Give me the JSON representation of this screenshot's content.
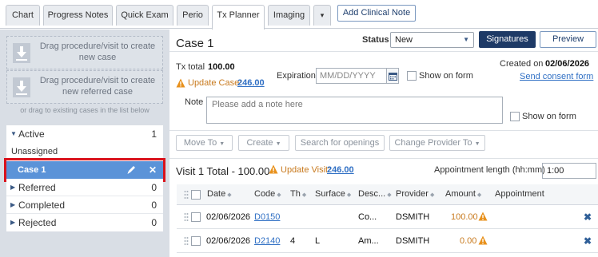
{
  "tabs": [
    {
      "label": "Chart",
      "active": false
    },
    {
      "label": "Progress Notes",
      "active": false
    },
    {
      "label": "Quick Exam",
      "active": false
    },
    {
      "label": "Perio",
      "active": false
    },
    {
      "label": "Tx Planner",
      "active": true
    },
    {
      "label": "Imaging",
      "active": false
    }
  ],
  "more_tab": "▾",
  "add_clinical_note": "Add Clinical Note",
  "left": {
    "drop_new_case": "Drag procedure/visit to create new case",
    "drop_new_referred": "Drag procedure/visit to create new referred case",
    "drag_hint": "or drag to existing cases in the list below",
    "groups": {
      "active": {
        "label": "Active",
        "count": "1"
      },
      "unassigned": {
        "label": "Unassigned"
      },
      "selected_case": {
        "label": "Case 1",
        "edit_icon": "pencil-icon",
        "remove": "✕"
      },
      "referred": {
        "label": "Referred",
        "count": "0"
      },
      "completed": {
        "label": "Completed",
        "count": "0"
      },
      "rejected": {
        "label": "Rejected",
        "count": "0"
      }
    }
  },
  "case": {
    "title": "Case 1",
    "status_label": "Status",
    "status_value": "New",
    "signatures": "Signatures",
    "preview": "Preview",
    "tx_total_label": "Tx total",
    "tx_total_value": "100.00",
    "update_case_label": "Update Case:",
    "update_case_value": "246.00",
    "expiration_label": "Expiration",
    "expiration_placeholder": "MM/DD/YYYY",
    "show_on_form_1": "Show on form",
    "created_on_label": "Created on",
    "created_on_value": "02/06/2026",
    "consent_link": "Send consent form",
    "note_label": "Note",
    "note_placeholder": "Please add a note here",
    "show_on_form_2": "Show on form"
  },
  "toolbar": {
    "move_to": "Move To",
    "create": "Create",
    "search": "Search for openings",
    "change_provider": "Change Provider To"
  },
  "visit": {
    "title": "Visit 1 Total - 100.00",
    "update_visit_label": "Update Visit:",
    "update_visit_value": "246.00",
    "appt_length_label": "Appointment length (hh:mm)",
    "appt_length_value": "1:00"
  },
  "table": {
    "headers": [
      "Date",
      "Code",
      "Th",
      "Surface",
      "Desc...",
      "Provider",
      "Amount",
      "Appointment"
    ],
    "rows": [
      {
        "date": "02/06/2026",
        "code": "D0150",
        "th": "",
        "surface": "",
        "desc": "Co...",
        "provider": "DSMITH",
        "amount": "100.00",
        "appointment": ""
      },
      {
        "date": "02/06/2026",
        "code": "D2140",
        "th": "4",
        "surface": "L",
        "desc": "Am...",
        "provider": "DSMITH",
        "amount": "0.00",
        "appointment": ""
      }
    ]
  },
  "colors": {
    "primary_dark": "#1e3a66",
    "link": "#2f6fc4",
    "warning": "#e8911c",
    "selected": "#5b93d8",
    "highlight": "#d9121c"
  }
}
